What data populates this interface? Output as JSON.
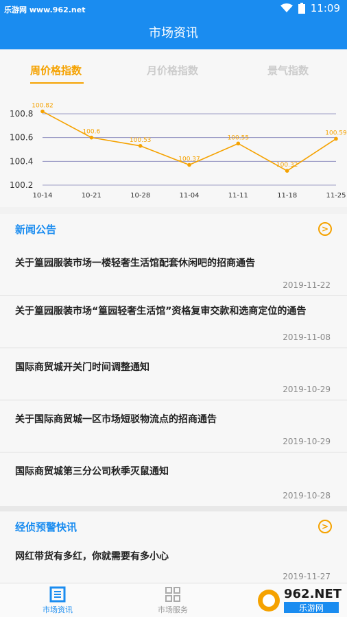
{
  "status_bar": {
    "site": "乐游网 www.962.net",
    "time": "11:09"
  },
  "header": {
    "title": "市场资讯"
  },
  "tabs": [
    {
      "label": "周价格指数",
      "active": true
    },
    {
      "label": "月价格指数",
      "active": false
    },
    {
      "label": "景气指数",
      "active": false
    }
  ],
  "chart_data": {
    "type": "line",
    "categories": [
      "10-14",
      "10-21",
      "10-28",
      "11-04",
      "11-11",
      "11-18",
      "11-25"
    ],
    "series": [
      {
        "values": [
          100.82,
          100.6,
          100.53,
          100.37,
          100.55,
          100.32,
          100.59
        ]
      }
    ],
    "data_labels": [
      "100.82",
      "100.6",
      "100.53",
      "100.37",
      "100.55",
      "100.32",
      "100.59"
    ],
    "y_ticks": [
      "100.2",
      "100.4",
      "100.6",
      "100.8"
    ],
    "ylim": [
      100.2,
      100.8
    ],
    "line_color": "#f5a200",
    "grid": true
  },
  "news_section": {
    "title": "新闻公告",
    "items": [
      {
        "title": "关于篁园服装市场一楼轻奢生活馆配套休闲吧的招商通告",
        "date": "2019-11-22"
      },
      {
        "title": "关于篁园服装市场“篁园轻奢生活馆”资格复审交款和选商定位的通告",
        "date": "2019-11-08"
      },
      {
        "title": "国际商贸城开关门时间调整通知",
        "date": "2019-10-29"
      },
      {
        "title": "关于国际商贸城一区市场短驳物流点的招商通告",
        "date": "2019-10-29"
      },
      {
        "title": "国际商贸城第三分公司秋季灭鼠通知",
        "date": "2019-10-28"
      }
    ]
  },
  "alert_section": {
    "title": "经侦预警快讯",
    "items": [
      {
        "title": "网红带货有多红，你就需要有多小心",
        "date": "2019-11-27"
      }
    ]
  },
  "bottom_nav": [
    {
      "label": "市场资讯",
      "icon": "news-icon",
      "active": true
    },
    {
      "label": "市场服务",
      "icon": "grid-icon",
      "active": false
    }
  ],
  "watermark": {
    "text_top": "962.NET",
    "text_bottom": "乐游网"
  },
  "colors": {
    "primary": "#1a8cf0",
    "accent": "#f5a200"
  }
}
